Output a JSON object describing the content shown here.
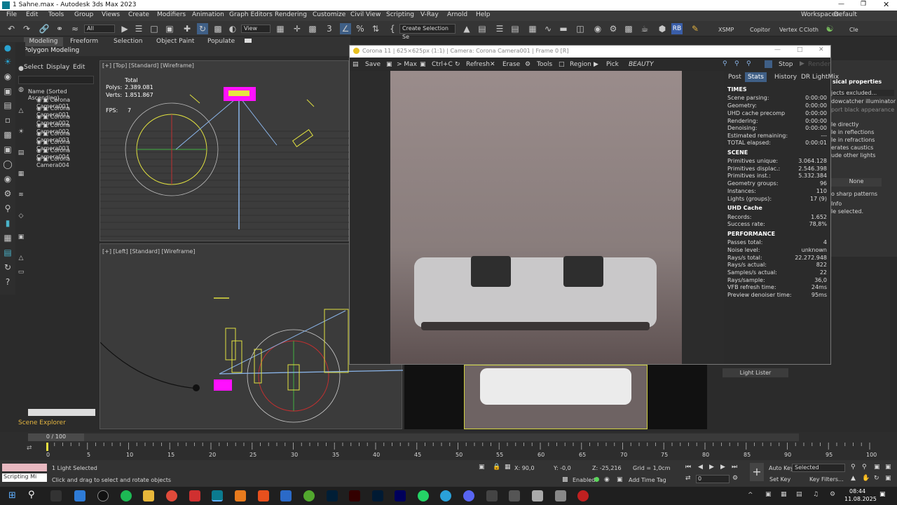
{
  "window": {
    "title": "1 Sahne.max - Autodesk 3ds Max 2023",
    "workspaces_label": "Workspaces:",
    "workspaces_value": "Default"
  },
  "menu": [
    "File",
    "Edit",
    "Tools",
    "Group",
    "Views",
    "Create",
    "Modifiers",
    "Animation",
    "Graph Editors",
    "Rendering",
    "Customize",
    "Civil View",
    "Scripting",
    "V-Ray",
    "Arnold",
    "Help"
  ],
  "toolbar": {
    "filter": "All",
    "view": "View",
    "selection_set": "Create Selection Se",
    "right_labels": [
      "XSMP",
      "Copitor",
      "Vertex C",
      "Cloth",
      "Cle"
    ]
  },
  "ribbon": {
    "tabs": [
      "Modeling",
      "Freeform",
      "Selection",
      "Object Paint",
      "Populate"
    ],
    "sub": "Polygon Modeling"
  },
  "scene": {
    "tabs": [
      "Select",
      "Display",
      "Edit"
    ],
    "header": "Name (Sorted Ascending)",
    "items": [
      "Corona Camera001",
      "Corona Camera001",
      "Corona Camera002",
      "Corona Camera002",
      "Corona Camera003",
      "Corona Camera003",
      "Corona Camera004",
      "Corona Camera004"
    ],
    "footer": "Scene Explorer"
  },
  "viewport_top": {
    "label": "[+] [Top] [Standard] [Wireframe]",
    "stats": {
      "total": "Total",
      "polys_label": "Polys:",
      "polys": "2.389.081",
      "verts_label": "Verts:",
      "verts": "1.851.867",
      "fps_label": "FPS:",
      "fps": "7"
    }
  },
  "viewport_left": {
    "label": "[+] [Left] [Standard] [Wireframe]"
  },
  "render": {
    "title": "Corona 11 | 625×625px (1:1) | Camera: Corona Camera001 | Frame 0 [R]",
    "buttons": [
      "Save",
      "> Max",
      "Ctrl+C",
      "Refresh",
      "Erase",
      "Tools",
      "Region",
      "Pick"
    ],
    "pass": "BEAUTY",
    "stop": "Stop",
    "render_btn": "Render",
    "tabs": [
      "Post",
      "Stats",
      "History",
      "DR",
      "LightMix"
    ],
    "sections": [
      {
        "title": "TIMES",
        "rows": [
          [
            "Scene parsing:",
            "0:00:00"
          ],
          [
            "Geometry:",
            "0:00:00"
          ],
          [
            "UHD cache precomp",
            "0:00:00"
          ],
          [
            "Rendering:",
            "0:00:00"
          ],
          [
            "Denoising:",
            "0:00:00"
          ],
          [
            "Estimated remaining:",
            "---"
          ],
          [
            "TOTAL elapsed:",
            "0:00:01"
          ]
        ]
      },
      {
        "title": "SCENE",
        "rows": [
          [
            "Primitives unique:",
            "3.064.128"
          ],
          [
            "Primitives displac.:",
            "2.546.398"
          ],
          [
            "Primitives inst.:",
            "5.332.384"
          ],
          [
            "Geometry groups:",
            "96"
          ],
          [
            "Instances:",
            "110"
          ],
          [
            "Lights (groups):",
            "17 (9)"
          ]
        ]
      },
      {
        "title": "UHD Cache",
        "rows": [
          [
            "Records:",
            "1.652"
          ],
          [
            "Success rate:",
            "78,8%"
          ]
        ]
      },
      {
        "title": "PERFORMANCE",
        "rows": [
          [
            "Passes total:",
            "4"
          ],
          [
            "Noise level:",
            "unknown"
          ],
          [
            "Rays/s total:",
            "22.272.948"
          ],
          [
            "Rays/s actual:",
            "822"
          ],
          [
            "Samples/s actual:",
            "22"
          ],
          [
            "Rays/sample:",
            "36,0"
          ],
          [
            "VFB refresh time:",
            "24ms"
          ],
          [
            "Preview denoiser time:",
            "95ms"
          ]
        ]
      }
    ]
  },
  "props_panel": {
    "title": "sical properties",
    "lines": [
      "jects excluded...",
      "dowcatcher illuminator",
      "port black appearance",
      "le directly",
      "le in reflections",
      "le in refractions",
      "erates caustics",
      "ude other lights"
    ],
    "none": "None",
    "sharp": "o sharp patterns",
    "info": "Info",
    "selected": "le selected.",
    "light_lister": "Light Lister"
  },
  "timeline": {
    "frame": "0 / 100",
    "ticks": [
      "0",
      "5",
      "10",
      "15",
      "20",
      "25",
      "30",
      "35",
      "40",
      "45",
      "50",
      "55",
      "60",
      "65",
      "70",
      "75",
      "80",
      "85",
      "90",
      "95",
      "100"
    ]
  },
  "status": {
    "script": "Scripting Mi",
    "selection": "1 Light Selected",
    "hint": "Click and drag to select and rotate objects",
    "x": "X: 90,0",
    "y": "Y: -0,0",
    "z": "Z: -25,216",
    "grid": "Grid = 1,0cm",
    "enabled": "Enabled:",
    "add_time_tag": "Add Time Tag",
    "auto_key": "Auto Key",
    "selected": "Selected",
    "set_key": "Set Key",
    "key_filters": "Key Filters...",
    "frame_field": "0"
  },
  "taskbar": {
    "time": "08:44",
    "date": "11.08.2025"
  }
}
